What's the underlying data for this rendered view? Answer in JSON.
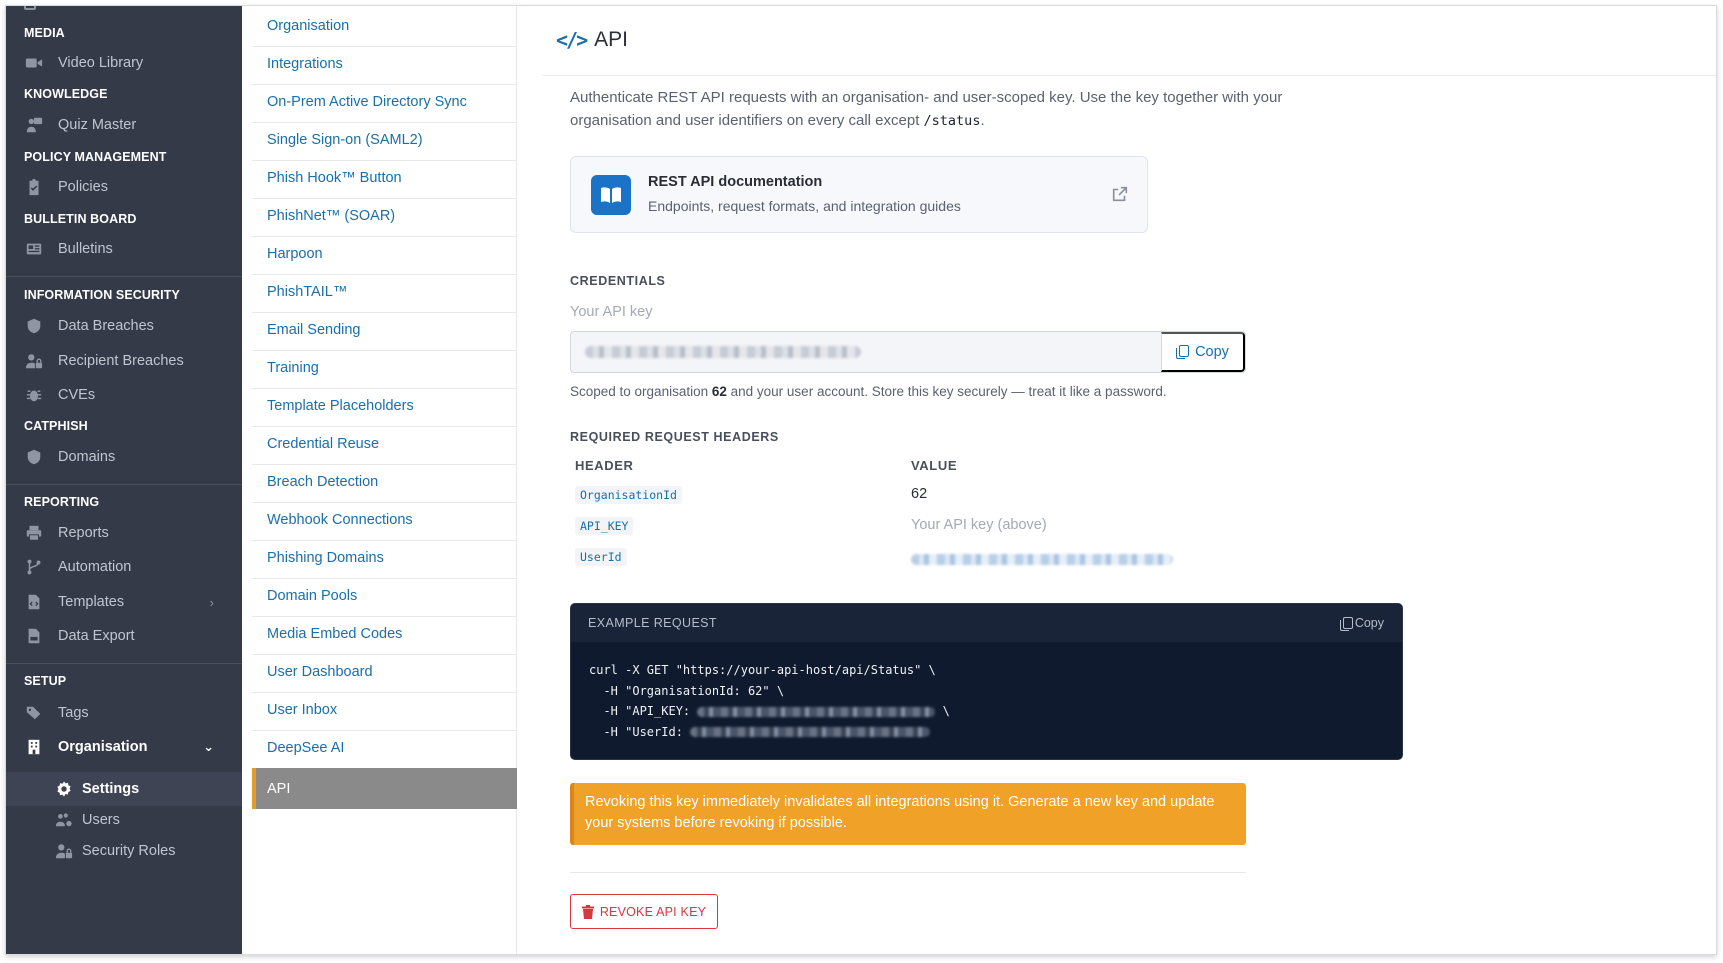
{
  "sidebar": {
    "sections": {
      "media": "MEDIA",
      "knowledge": "KNOWLEDGE",
      "policy": "POLICY MANAGEMENT",
      "bulletin": "BULLETIN BOARD",
      "infosec": "INFORMATION SECURITY",
      "catphish": "CATPHISH",
      "reporting": "REPORTING",
      "setup": "SETUP"
    },
    "items": {
      "video_library": "Video Library",
      "quiz_master": "Quiz Master",
      "policies": "Policies",
      "bulletins": "Bulletins",
      "data_breaches": "Data Breaches",
      "recipient_breaches": "Recipient Breaches",
      "cves": "CVEs",
      "domains": "Domains",
      "reports": "Reports",
      "automation": "Automation",
      "templates": "Templates",
      "data_export": "Data Export",
      "tags": "Tags",
      "organisation": "Organisation",
      "settings": "Settings",
      "users": "Users",
      "security_roles": "Security Roles"
    }
  },
  "submenu": [
    "Organisation",
    "Integrations",
    "On-Prem Active Directory Sync",
    "Single Sign-on (SAML2)",
    "Phish Hook™ Button",
    "PhishNet™ (SOAR)",
    "Harpoon",
    "PhishTAIL™",
    "Email Sending",
    "Training",
    "Template Placeholders",
    "Credential Reuse",
    "Breach Detection",
    "Webhook Connections",
    "Phishing Domains",
    "Domain Pools",
    "Media Embed Codes",
    "User Dashboard",
    "User Inbox",
    "DeepSee AI",
    "API"
  ],
  "main": {
    "title": "API",
    "intro_text": "Authenticate REST API requests with an organisation- and user-scoped key. Use the key together with your organisation and user identifiers on every call except ",
    "intro_code": "/status",
    "intro_end": ".",
    "doc_card": {
      "title": "REST API documentation",
      "subtitle": "Endpoints, request formats, and integration guides"
    },
    "credentials_label": "CREDENTIALS",
    "api_key_label": "Your API key",
    "copy_label": "Copy",
    "scope_pre": "Scoped to organisation ",
    "scope_org": "62",
    "scope_post": " and your user account. Store this key securely — treat it like a password.",
    "headers_label": "REQUIRED REQUEST HEADERS",
    "headers_table": {
      "col_header": "HEADER",
      "col_value": "VALUE",
      "rows": [
        {
          "name": "OrganisationId",
          "value": "62"
        },
        {
          "name": "API_KEY",
          "value": "Your API key (above)"
        },
        {
          "name": "UserId",
          "value": ""
        }
      ]
    },
    "example": {
      "label": "EXAMPLE REQUEST",
      "copy": "Copy",
      "line1": "curl -X GET \"https://your-api-host/api/Status\" \\",
      "line2": "  -H \"OrganisationId: 62\" \\",
      "line3_pre": "  -H \"API_KEY: ",
      "line3_post": " \\",
      "line4_pre": "  -H \"UserId: "
    },
    "warning": "Revoking this key immediately invalidates all integrations using it. Generate a new key and update your systems before revoking if possible.",
    "revoke_label": "REVOKE API KEY"
  },
  "colors": {
    "sidebar_bg": "#353a48",
    "link": "#1a6fa8",
    "active_tab": "#8a8a8a",
    "warning": "#f0a128",
    "danger": "#d9363e",
    "code_bg": "#0f1a2e"
  }
}
